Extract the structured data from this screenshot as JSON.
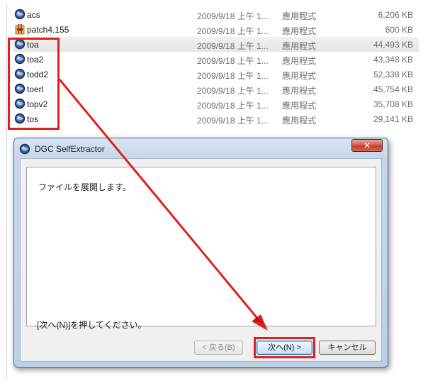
{
  "files": [
    {
      "name": "acs",
      "date": "2009/9/18 上午 1...",
      "type": "應用程式",
      "size": "6,206 KB",
      "icon": "app-globe-icon"
    },
    {
      "name": "patch4.155",
      "date": "2009/9/18 上午 1...",
      "type": "應用程式",
      "size": "600 KB",
      "icon": "archive-icon"
    },
    {
      "name": "toa",
      "date": "2009/9/18 上午 1...",
      "type": "應用程式",
      "size": "44,493 KB",
      "icon": "app-globe-icon"
    },
    {
      "name": "toa2",
      "date": "2009/9/18 上午 1...",
      "type": "應用程式",
      "size": "43,348 KB",
      "icon": "app-globe-icon"
    },
    {
      "name": "todd2",
      "date": "2009/9/18 上午 1...",
      "type": "應用程式",
      "size": "52,338 KB",
      "icon": "app-globe-icon"
    },
    {
      "name": "toerl",
      "date": "2009/9/18 上午 1...",
      "type": "應用程式",
      "size": "45,754 KB",
      "icon": "app-globe-icon"
    },
    {
      "name": "topv2",
      "date": "2009/9/18 上午 1...",
      "type": "應用程式",
      "size": "35,708 KB",
      "icon": "app-globe-icon"
    },
    {
      "name": "tos",
      "date": "2009/9/18 上午 1...",
      "type": "應用程式",
      "size": "29,141 KB",
      "icon": "app-globe-icon"
    }
  ],
  "dialog": {
    "title": "DGC SelfExtractor",
    "close_label": "✕",
    "message_top": "ファイルを展開します。",
    "message_bottom": "[次へ(N)]を押してください。",
    "back_label": "< 戻る(B)",
    "next_label": "次へ(N) >",
    "cancel_label": "キャンセル"
  },
  "colors": {
    "annotation_red": "#e0201e",
    "selected_row": "#e9e9e9",
    "title_bar": "#c4d7ea"
  }
}
